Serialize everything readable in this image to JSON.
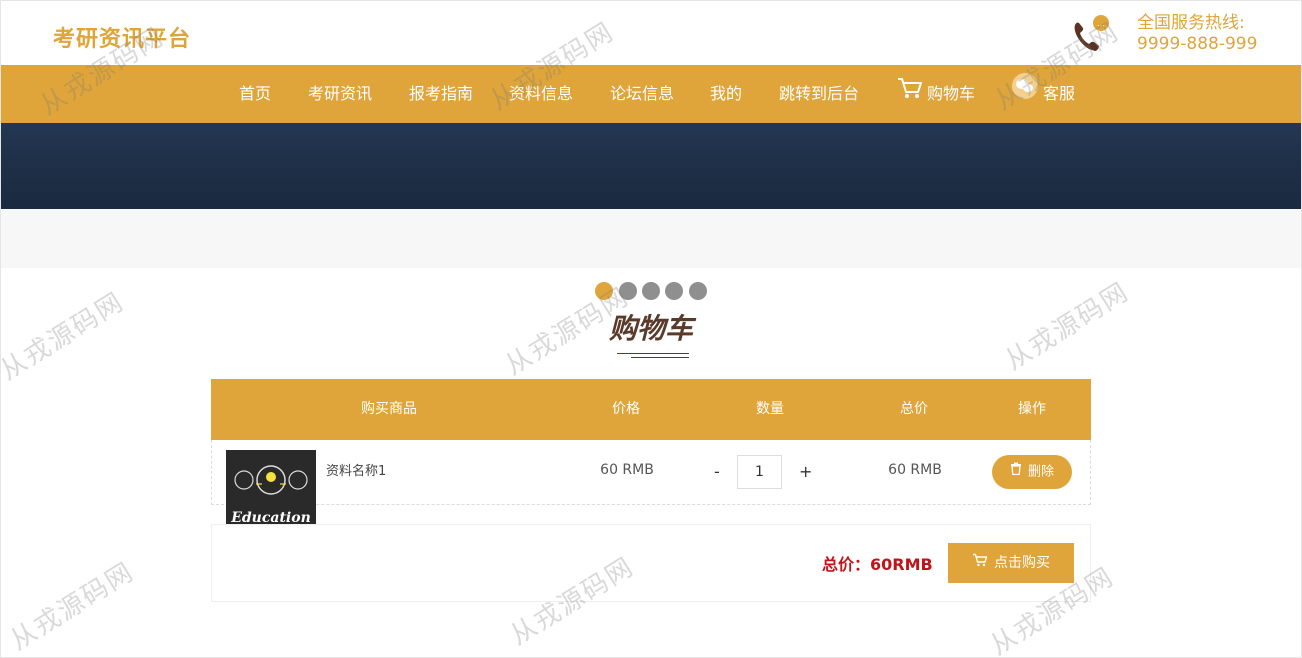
{
  "header": {
    "logo": "考研资讯平台",
    "hotline_label": "全国服务热线:",
    "hotline_number": "9999-888-999"
  },
  "nav": {
    "items": [
      "首页",
      "考研资讯",
      "报考指南",
      "资料信息",
      "论坛信息",
      "我的",
      "跳转到后台"
    ],
    "cart": "购物车",
    "service": "客服"
  },
  "carousel": {
    "dots": 5,
    "active_index": 0
  },
  "cart": {
    "title": "购物车",
    "headers": [
      "购买商品",
      "价格",
      "数量",
      "总价",
      "操作"
    ],
    "items": [
      {
        "name": "资料名称1",
        "thumb_text": "Education",
        "price": "60 RMB",
        "quantity": "1",
        "total": "60 RMB"
      }
    ],
    "minus": "-",
    "plus": "+",
    "delete_label": "删除",
    "grand_total": "总价：60RMB",
    "buy_label": "点击购买"
  },
  "watermark": "从戎源码网",
  "colors": {
    "accent": "#dfa53b",
    "banner": "#1e2f47",
    "total_red": "#c0141a",
    "title_brown": "#5a3a2a"
  }
}
